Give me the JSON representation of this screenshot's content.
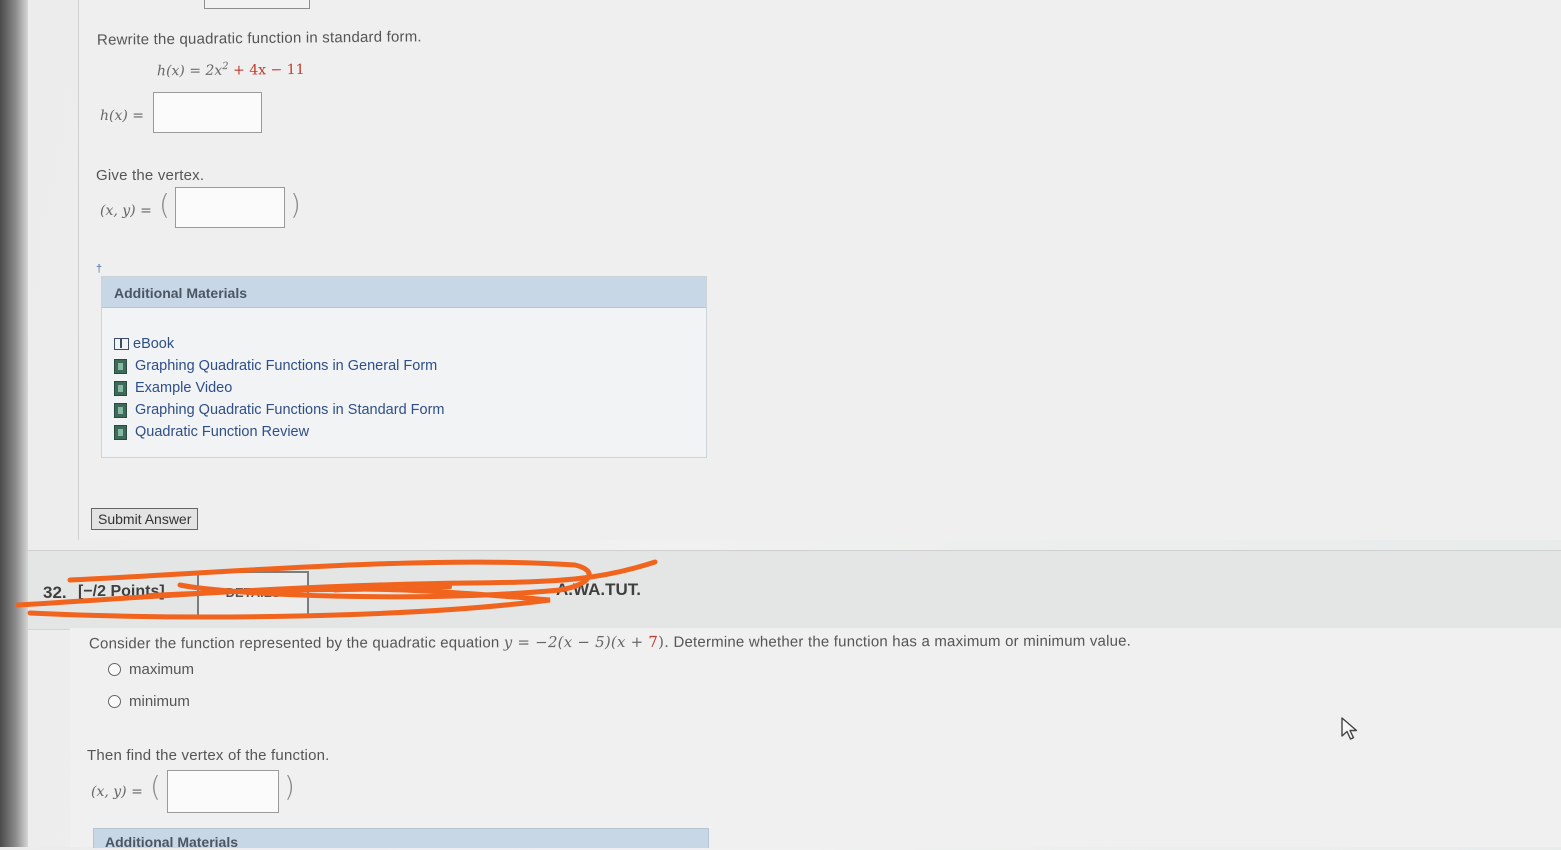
{
  "q31": {
    "prompt_standard_form": "Rewrite the quadratic function in standard form.",
    "given_lhs": "h(x) = 2x",
    "given_exp": "2",
    "given_mid": " + 4x − ",
    "given_const": "11",
    "answer_label": "h(x) =",
    "prompt_vertex": "Give the vertex.",
    "vertex_label": "(x, y) =",
    "paren_open": "(",
    "paren_close": ")",
    "dagger": "†",
    "additional_materials": {
      "title": "Additional Materials",
      "links": [
        {
          "label": "eBook",
          "icon": "book-icon"
        },
        {
          "label": "Graphing Quadratic Functions in General Form",
          "icon": "video-icon"
        },
        {
          "label": "Example Video",
          "icon": "video-icon"
        },
        {
          "label": "Graphing Quadratic Functions in Standard Form",
          "icon": "video-icon"
        },
        {
          "label": "Quadratic Function Review",
          "icon": "video-icon"
        }
      ]
    },
    "submit_label": "Submit Answer"
  },
  "q32": {
    "number": "32.",
    "points": "[−/2 Points]",
    "details": "DETAILS",
    "source_tail": "A.WA.TUT.",
    "prompt_start": "Consider the function represented by the quadratic equation ",
    "equation": "y = −2(x − 5)(x + ",
    "equation_red": "7",
    "equation_end": ").",
    "prompt_end": " Determine whether the function has a maximum or minimum value.",
    "options": [
      "maximum",
      "minimum"
    ],
    "prompt_vertex": "Then find the vertex of the function.",
    "vertex_label": "(x, y) =",
    "paren_open": "(",
    "paren_close": ")",
    "additional_materials_title": "Additional Materials"
  },
  "annotation_color": "#f0641e"
}
